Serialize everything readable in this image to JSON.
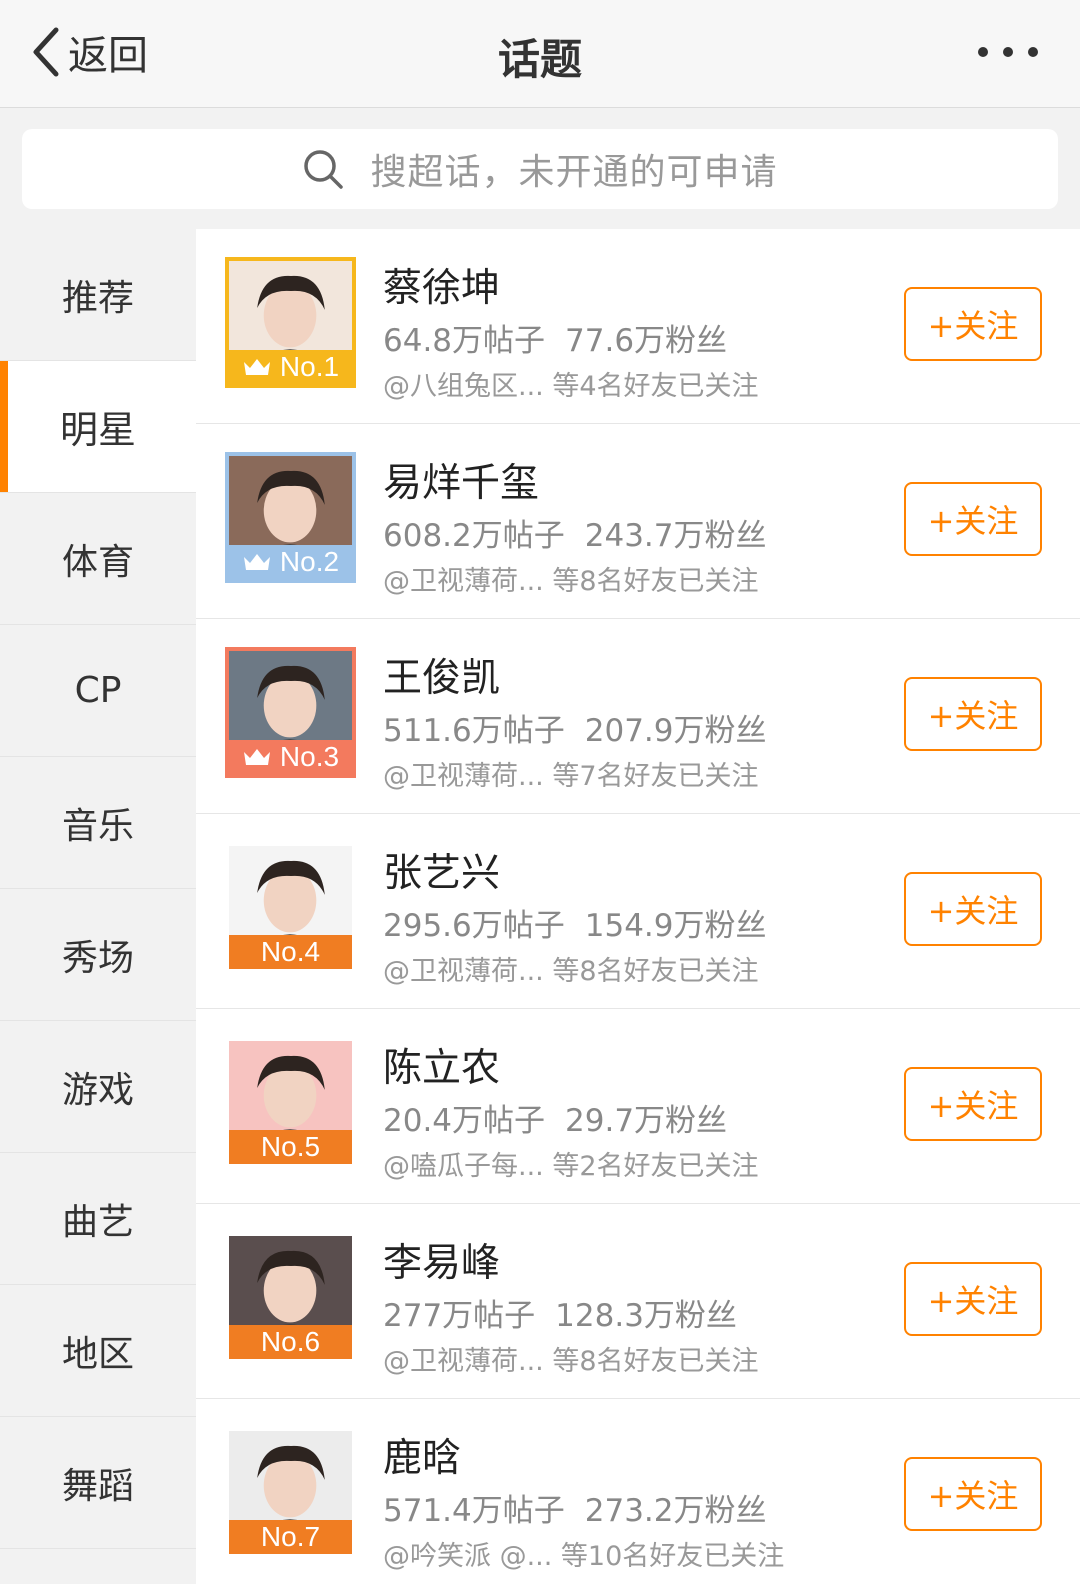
{
  "header": {
    "back_label": "返回",
    "title": "话题"
  },
  "search": {
    "placeholder": "搜超话，未开通的可申请"
  },
  "sidebar": {
    "items": [
      {
        "label": "推荐",
        "active": false
      },
      {
        "label": "明星",
        "active": true
      },
      {
        "label": "体育",
        "active": false
      },
      {
        "label": "CP",
        "active": false
      },
      {
        "label": "音乐",
        "active": false
      },
      {
        "label": "秀场",
        "active": false
      },
      {
        "label": "游戏",
        "active": false
      },
      {
        "label": "曲艺",
        "active": false
      },
      {
        "label": "地区",
        "active": false
      },
      {
        "label": "舞蹈",
        "active": false
      }
    ]
  },
  "colors": {
    "accent": "#ff8200",
    "gold": "#f6b71c",
    "silver": "#9cc2e8",
    "bronze": "#f37a5e"
  },
  "topics": [
    {
      "rank": "No.1",
      "rank_color": "#f6b71c",
      "crown": true,
      "bg": "#f2e6dc",
      "name": "蔡徐坤",
      "posts": "64.8万帖子",
      "fans": "77.6万粉丝",
      "friends": "@八组兔区... 等4名好友已关注",
      "follow_label": "+关注"
    },
    {
      "rank": "No.2",
      "rank_color": "#9cc2e8",
      "crown": true,
      "bg": "#8a6a5a",
      "name": "易烊千玺",
      "posts": "608.2万帖子",
      "fans": "243.7万粉丝",
      "friends": "@卫视薄荷... 等8名好友已关注",
      "follow_label": "+关注"
    },
    {
      "rank": "No.3",
      "rank_color": "#f37a5e",
      "crown": true,
      "bg": "#6d7985",
      "name": "王俊凯",
      "posts": "511.6万帖子",
      "fans": "207.9万粉丝",
      "friends": "@卫视薄荷... 等7名好友已关注",
      "follow_label": "+关注"
    },
    {
      "rank": "No.4",
      "rank_color": "#f07d22",
      "crown": false,
      "bg": "#f4f4f4",
      "name": "张艺兴",
      "posts": "295.6万帖子",
      "fans": "154.9万粉丝",
      "friends": "@卫视薄荷... 等8名好友已关注",
      "follow_label": "+关注"
    },
    {
      "rank": "No.5",
      "rank_color": "#f07d22",
      "crown": false,
      "bg": "#f7c3c0",
      "name": "陈立农",
      "posts": "20.4万帖子",
      "fans": "29.7万粉丝",
      "friends": "@嗑瓜子每... 等2名好友已关注",
      "follow_label": "+关注"
    },
    {
      "rank": "No.6",
      "rank_color": "#f07d22",
      "crown": false,
      "bg": "#5a4e4e",
      "name": "李易峰",
      "posts": "277万帖子",
      "fans": "128.3万粉丝",
      "friends": "@卫视薄荷... 等8名好友已关注",
      "follow_label": "+关注"
    },
    {
      "rank": "No.7",
      "rank_color": "#f07d22",
      "crown": false,
      "bg": "#ececec",
      "name": "鹿晗",
      "posts": "571.4万帖子",
      "fans": "273.2万粉丝",
      "friends": "@吟笑派 @... 等10名好友已关注",
      "follow_label": "+关注"
    }
  ]
}
